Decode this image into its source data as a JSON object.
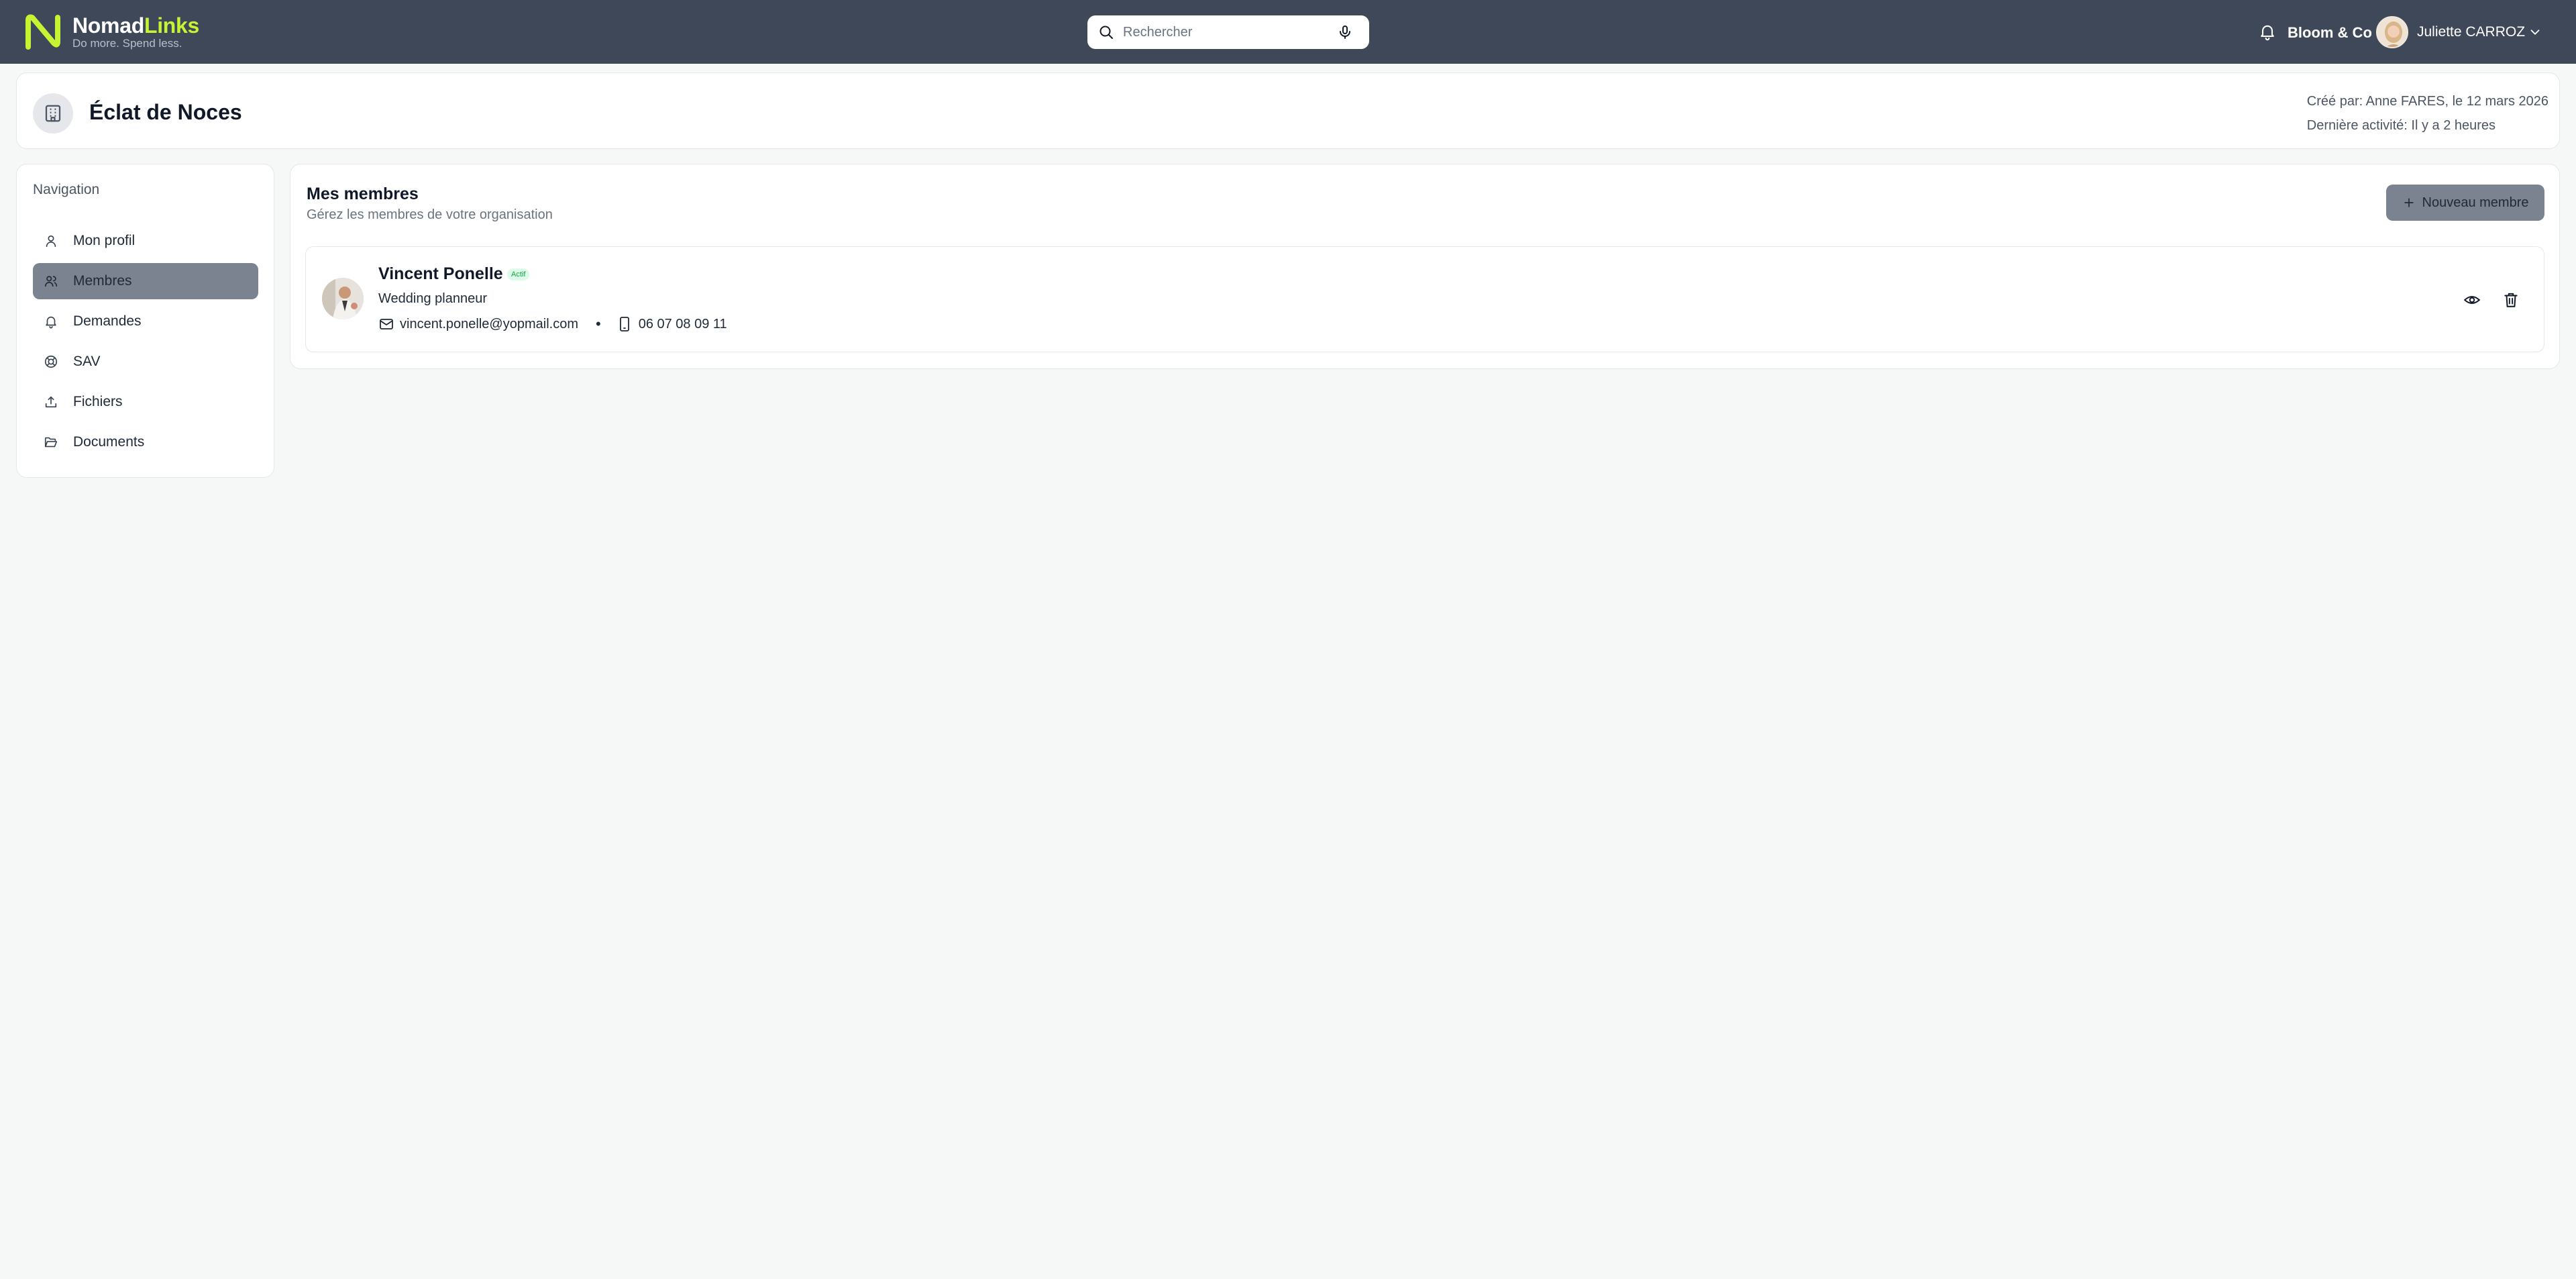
{
  "brand": {
    "name_part1": "Nomad",
    "name_part2": "Links",
    "tagline": "Do more. Spend less.",
    "accent_color": "#c6f432",
    "topbar_color": "#3f4858"
  },
  "search": {
    "placeholder": "Rechercher"
  },
  "header": {
    "organization": "Bloom & Co",
    "user_name": "Juliette CARROZ"
  },
  "org": {
    "title": "Éclat de Noces",
    "created_by": "Créé par: Anne FARES, le 12 mars 2026",
    "last_activity": "Dernière activité: Il y a 2 heures"
  },
  "sidebar": {
    "title": "Navigation",
    "items": [
      {
        "label": "Mon profil",
        "icon": "user-icon",
        "active": false
      },
      {
        "label": "Membres",
        "icon": "users-icon",
        "active": true
      },
      {
        "label": "Demandes",
        "icon": "bell-icon",
        "active": false
      },
      {
        "label": "SAV",
        "icon": "lifebuoy-icon",
        "active": false
      },
      {
        "label": "Fichiers",
        "icon": "upload-icon",
        "active": false
      },
      {
        "label": "Documents",
        "icon": "folder-open-icon",
        "active": false
      }
    ]
  },
  "members": {
    "title": "Mes membres",
    "subtitle": "Gérez les membres de votre organisation",
    "new_button": "Nouveau membre",
    "list": [
      {
        "name": "Vincent Ponelle",
        "status": "Actif",
        "role": "Wedding planneur",
        "email": "vincent.ponelle@yopmail.com",
        "phone": "06 07 08 09 11"
      }
    ]
  }
}
